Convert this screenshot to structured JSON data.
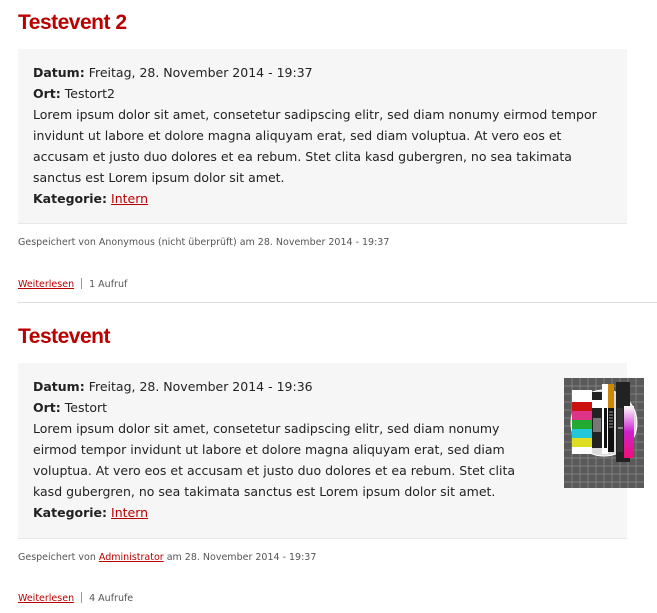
{
  "colors": {
    "accent": "#bb0000",
    "box_background": "#f6f6f6",
    "meta_text": "#555555"
  },
  "labels": {
    "datum": "Datum:",
    "ort": "Ort:",
    "kategorie": "Kategorie:"
  },
  "articles": [
    {
      "title": "Testevent 2",
      "datum": "Freitag, 28. November 2014 - 19:37",
      "ort": "Testort2",
      "description": "Lorem ipsum dolor sit amet, consetetur sadipscing elitr, sed diam nonumy eirmod tempor invidunt ut labore et dolore magna aliquyam erat, sed diam voluptua. At vero eos et accusam et justo duo dolores et ea rebum. Stet clita kasd gubergren, no sea takimata sanctus est Lorem ipsum dolor sit amet.",
      "kategorie": "Intern",
      "saved_by_prefix": "Gespeichert von",
      "author": "Anonymous (nicht überprüft)",
      "saved_at": "am 28. November 2014 - 19:37",
      "read_more": "Weiterlesen",
      "views": "1 Aufruf"
    },
    {
      "title": "Testevent",
      "datum": "Freitag, 28. November 2014 - 19:36",
      "ort": "Testort",
      "description": "Lorem ipsum dolor sit amet, consetetur sadipscing elitr, sed diam nonumy eirmod tempor invidunt ut labore et dolore magna aliquyam erat, sed diam voluptua. At vero eos et accusam et justo duo dolores et ea rebum. Stet clita kasd gubergren, no sea takimata sanctus est Lorem ipsum dolor sit amet.",
      "kategorie": "Intern",
      "saved_by_prefix": "Gespeichert von",
      "author": "Administrator",
      "saved_at": "am 28. November 2014 - 19:37",
      "read_more": "Weiterlesen",
      "views": "4 Aufrufe",
      "image": "test-card-image"
    }
  ]
}
